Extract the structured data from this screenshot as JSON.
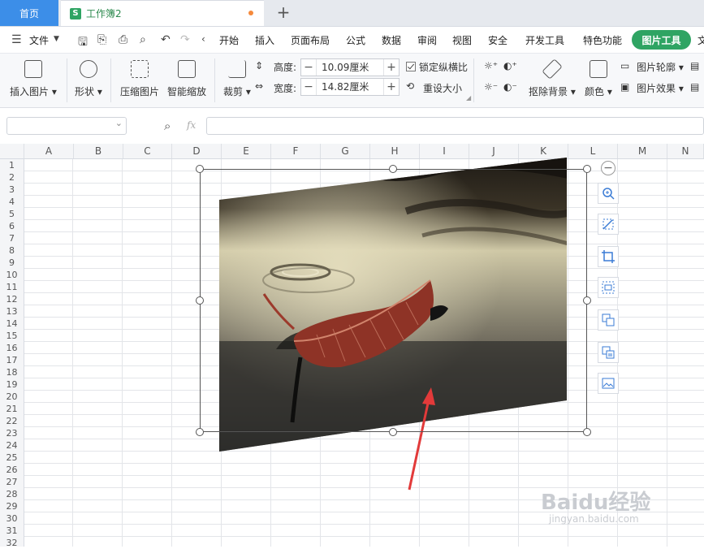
{
  "tabs": {
    "home": "首页",
    "doc_icon_letter": "S",
    "doc_title": "工作簿2"
  },
  "menu": {
    "file": "文件",
    "items": [
      "开始",
      "插入",
      "页面布局",
      "公式",
      "数据",
      "审阅",
      "视图",
      "安全",
      "开发工具",
      "特色功能"
    ],
    "active": "图片工具",
    "overflow": "文"
  },
  "ribbon": {
    "insert_picture": "插入图片",
    "shape": "形状",
    "compress": "压缩图片",
    "smart_zoom": "智能缩放",
    "crop": "裁剪",
    "height_label": "高度:",
    "height_value": "10.09厘米",
    "width_label": "宽度:",
    "width_value": "14.82厘米",
    "lock_ratio": "锁定纵横比",
    "reset_size": "重设大小",
    "remove_bg": "抠除背景",
    "color": "颜色",
    "outline": "图片轮廓",
    "effects": "图片效果"
  },
  "formula_bar": {
    "fx": "fx",
    "name_value": "",
    "formula_value": ""
  },
  "columns": [
    "A",
    "B",
    "C",
    "D",
    "E",
    "F",
    "G",
    "H",
    "I",
    "J",
    "K",
    "L",
    "M",
    "N"
  ],
  "rows": [
    "1",
    "2",
    "3",
    "4",
    "5",
    "6",
    "7",
    "8",
    "9",
    "10",
    "11",
    "12",
    "13",
    "14",
    "15",
    "16",
    "17",
    "18",
    "19",
    "20",
    "21",
    "22",
    "23",
    "24",
    "25",
    "26",
    "27",
    "28",
    "29",
    "30",
    "31",
    "32"
  ],
  "watermark": {
    "main": "Baidu经验",
    "sub": "jingyan.baidu.com"
  },
  "colors": {
    "accent_green": "#2fa463",
    "home_tab_blue": "#3c8ee8",
    "arrow_red": "#e23a3a"
  }
}
